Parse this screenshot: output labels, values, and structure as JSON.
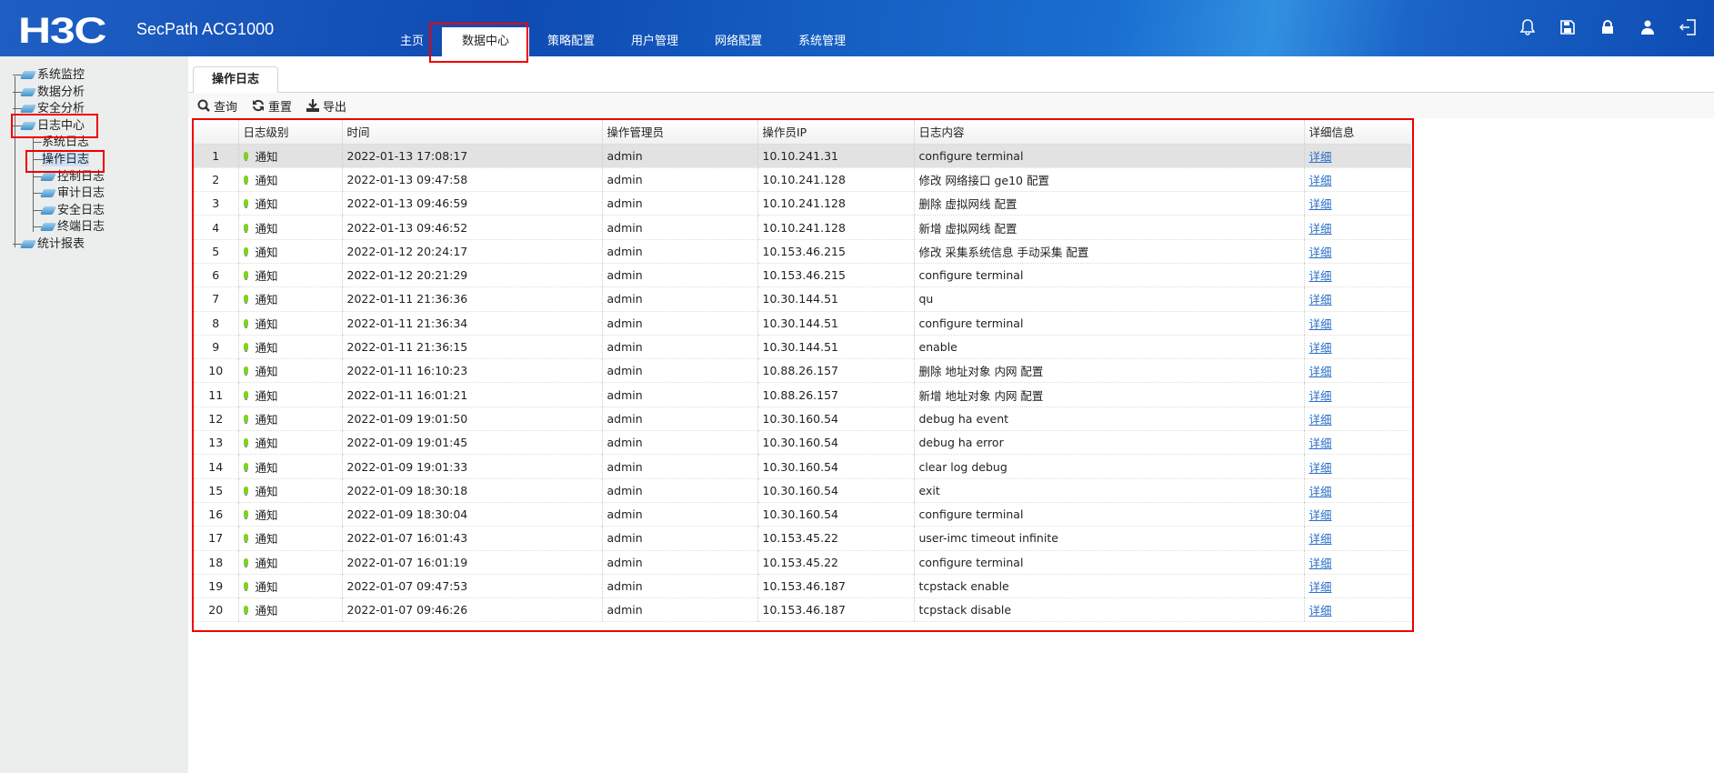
{
  "header": {
    "logo": "H3C",
    "product": "SecPath ACG1000",
    "nav": [
      "主页",
      "数据中心",
      "策略配置",
      "用户管理",
      "网络配置",
      "系统管理"
    ],
    "active_nav": 1,
    "icons": [
      "bell-icon",
      "save-icon",
      "lock-icon",
      "user-icon",
      "logout-icon"
    ]
  },
  "sidebar": {
    "items": [
      "系统监控",
      "数据分析",
      "安全分析",
      "日志中心"
    ],
    "children": [
      "系统日志",
      "操作日志",
      "控制日志",
      "审计日志",
      "安全日志",
      "终端日志"
    ],
    "last": "统计报表"
  },
  "main": {
    "tab": "操作日志",
    "toolbar": {
      "query": "查询",
      "reset": "重置",
      "export": "导出"
    },
    "columns": [
      "",
      "日志级别",
      "时间",
      "操作管理员",
      "操作员IP",
      "日志内容",
      "详细信息"
    ],
    "rows": [
      [
        "1",
        "通知",
        "2022-01-13 17:08:17",
        "admin",
        "10.10.241.31",
        "configure terminal",
        "详细"
      ],
      [
        "2",
        "通知",
        "2022-01-13 09:47:58",
        "admin",
        "10.10.241.128",
        "修改 网络接口 ge10 配置",
        "详细"
      ],
      [
        "3",
        "通知",
        "2022-01-13 09:46:59",
        "admin",
        "10.10.241.128",
        "删除 虚拟网线 配置",
        "详细"
      ],
      [
        "4",
        "通知",
        "2022-01-13 09:46:52",
        "admin",
        "10.10.241.128",
        "新增 虚拟网线 配置",
        "详细"
      ],
      [
        "5",
        "通知",
        "2022-01-12 20:24:17",
        "admin",
        "10.153.46.215",
        "修改 采集系统信息 手动采集 配置",
        "详细"
      ],
      [
        "6",
        "通知",
        "2022-01-12 20:21:29",
        "admin",
        "10.153.46.215",
        "configure terminal",
        "详细"
      ],
      [
        "7",
        "通知",
        "2022-01-11 21:36:36",
        "admin",
        "10.30.144.51",
        "qu",
        "详细"
      ],
      [
        "8",
        "通知",
        "2022-01-11 21:36:34",
        "admin",
        "10.30.144.51",
        "configure terminal",
        "详细"
      ],
      [
        "9",
        "通知",
        "2022-01-11 21:36:15",
        "admin",
        "10.30.144.51",
        "enable",
        "详细"
      ],
      [
        "10",
        "通知",
        "2022-01-11 16:10:23",
        "admin",
        "10.88.26.157",
        "删除 地址对象 内网 配置",
        "详细"
      ],
      [
        "11",
        "通知",
        "2022-01-11 16:01:21",
        "admin",
        "10.88.26.157",
        "新增 地址对象 内网 配置",
        "详细"
      ],
      [
        "12",
        "通知",
        "2022-01-09 19:01:50",
        "admin",
        "10.30.160.54",
        "debug ha event",
        "详细"
      ],
      [
        "13",
        "通知",
        "2022-01-09 19:01:45",
        "admin",
        "10.30.160.54",
        "debug ha error",
        "详细"
      ],
      [
        "14",
        "通知",
        "2022-01-09 19:01:33",
        "admin",
        "10.30.160.54",
        "clear log debug",
        "详细"
      ],
      [
        "15",
        "通知",
        "2022-01-09 18:30:18",
        "admin",
        "10.30.160.54",
        "exit",
        "详细"
      ],
      [
        "16",
        "通知",
        "2022-01-09 18:30:04",
        "admin",
        "10.30.160.54",
        "configure terminal",
        "详细"
      ],
      [
        "17",
        "通知",
        "2022-01-07 16:01:43",
        "admin",
        "10.153.45.22",
        "user-imc timeout infinite",
        "详细"
      ],
      [
        "18",
        "通知",
        "2022-01-07 16:01:19",
        "admin",
        "10.153.45.22",
        "configure terminal",
        "详细"
      ],
      [
        "19",
        "通知",
        "2022-01-07 09:47:53",
        "admin",
        "10.153.46.187",
        "tcpstack enable",
        "详细"
      ],
      [
        "20",
        "通知",
        "2022-01-07 09:46:26",
        "admin",
        "10.153.46.187",
        "tcpstack disable",
        "详细"
      ]
    ]
  }
}
